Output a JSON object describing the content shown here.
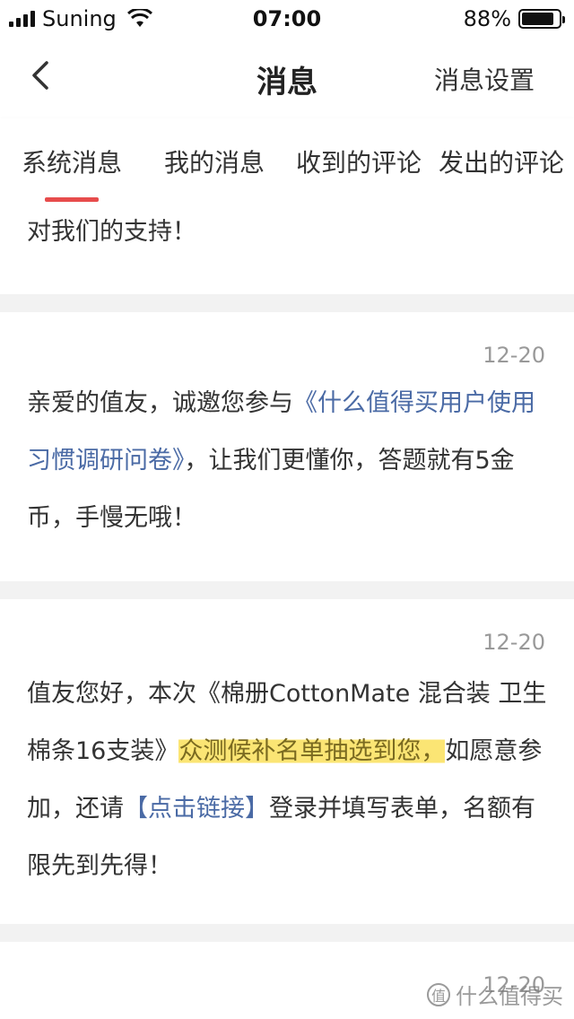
{
  "status": {
    "carrier": "Suning",
    "time": "07:00",
    "battery": "88%",
    "battery_level": 0.88
  },
  "nav": {
    "title": "消息",
    "settings_label": "消息设置",
    "back_icon": "chevron-left-icon"
  },
  "tabs": [
    {
      "label": "系统消息",
      "active": true
    },
    {
      "label": "我的消息"
    },
    {
      "label": "收到的评论"
    },
    {
      "label": "发出的评论"
    }
  ],
  "accent_color": "#e74c4c",
  "link_color": "#4a6aa5",
  "messages": [
    {
      "text_tail": "对我们的支持！"
    },
    {
      "date": "12-20",
      "text_before": "亲爱的值友，诚邀您参与",
      "link": "《什么值得买用户使用习惯调研问卷》",
      "text_after": "，让我们更懂你，答题就有5金币，手慢无哦！"
    },
    {
      "date": "12-20",
      "text_before": "值友您好，本次《棉册CottonMate 混合装 卫生棉条16支装》",
      "highlight": "众测候补名单抽选到您，",
      "text_middle": "如愿意参加，还请",
      "link": "【点击链接】",
      "text_after": "登录并填写表单，名额有限先到先得！"
    },
    {
      "date": "12-20"
    }
  ],
  "watermark": "什么值得买"
}
